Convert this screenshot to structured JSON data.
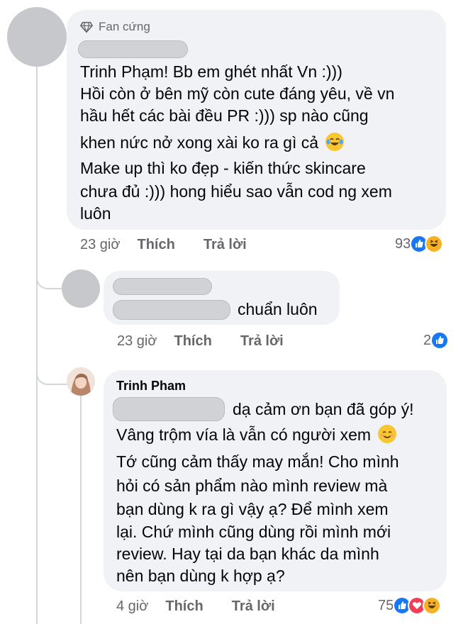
{
  "comment1": {
    "badge": "Fan cứng",
    "lines": [
      "Trinh Phạm! Bb em ghét nhất Vn :)))",
      "Hồi còn ở bên mỹ còn cute đáng yêu, về vn",
      "hầu hết các bài đều PR :))) sp nào cũng",
      "khen nức nở xong xài ko ra gì cả",
      "Make up thì ko đẹp - kiến thức skincare",
      "chưa đủ :))) hong hiểu sao vẫn cod ng xem",
      "luôn"
    ],
    "emoji_line3": "laughing-tears-emoji",
    "time": "23 giờ",
    "like_label": "Thích",
    "reply_label": "Trả lời",
    "reaction_count": "93",
    "reactions": [
      "like",
      "haha"
    ]
  },
  "reply1": {
    "text": "chuẩn luôn",
    "time": "23 giờ",
    "like_label": "Thích",
    "reply_label": "Trả lời",
    "reaction_count": "2",
    "reactions": [
      "like"
    ]
  },
  "reply2": {
    "author": "Trinh Pham",
    "lines": [
      "dạ cảm ơn bạn đã góp ý!",
      "Vâng trộm vía là vẫn có người xem",
      "Tớ cũng cảm thấy may mắn! Cho mình",
      "hỏi có sản phẩm nào mình review mà",
      "bạn dùng k ra gì vậy ạ? Để mình xem",
      "lại. Chứ mình cũng dùng rồi mình mới",
      "review. Hay tại da bạn khác da mình",
      "nên bạn dùng k hợp ạ?"
    ],
    "emoji_line2": "smiling-blush-emoji",
    "time": "4 giờ",
    "like_label": "Thích",
    "reply_label": "Trả lời",
    "reaction_count": "75",
    "reactions": [
      "like",
      "love",
      "haha"
    ]
  },
  "colors": {
    "bubble": "#f0f2f5",
    "meta_text": "#65676b",
    "like_blue": "#1877f2",
    "love_red": "#f33e58",
    "haha_yellow": "#f7b125"
  }
}
